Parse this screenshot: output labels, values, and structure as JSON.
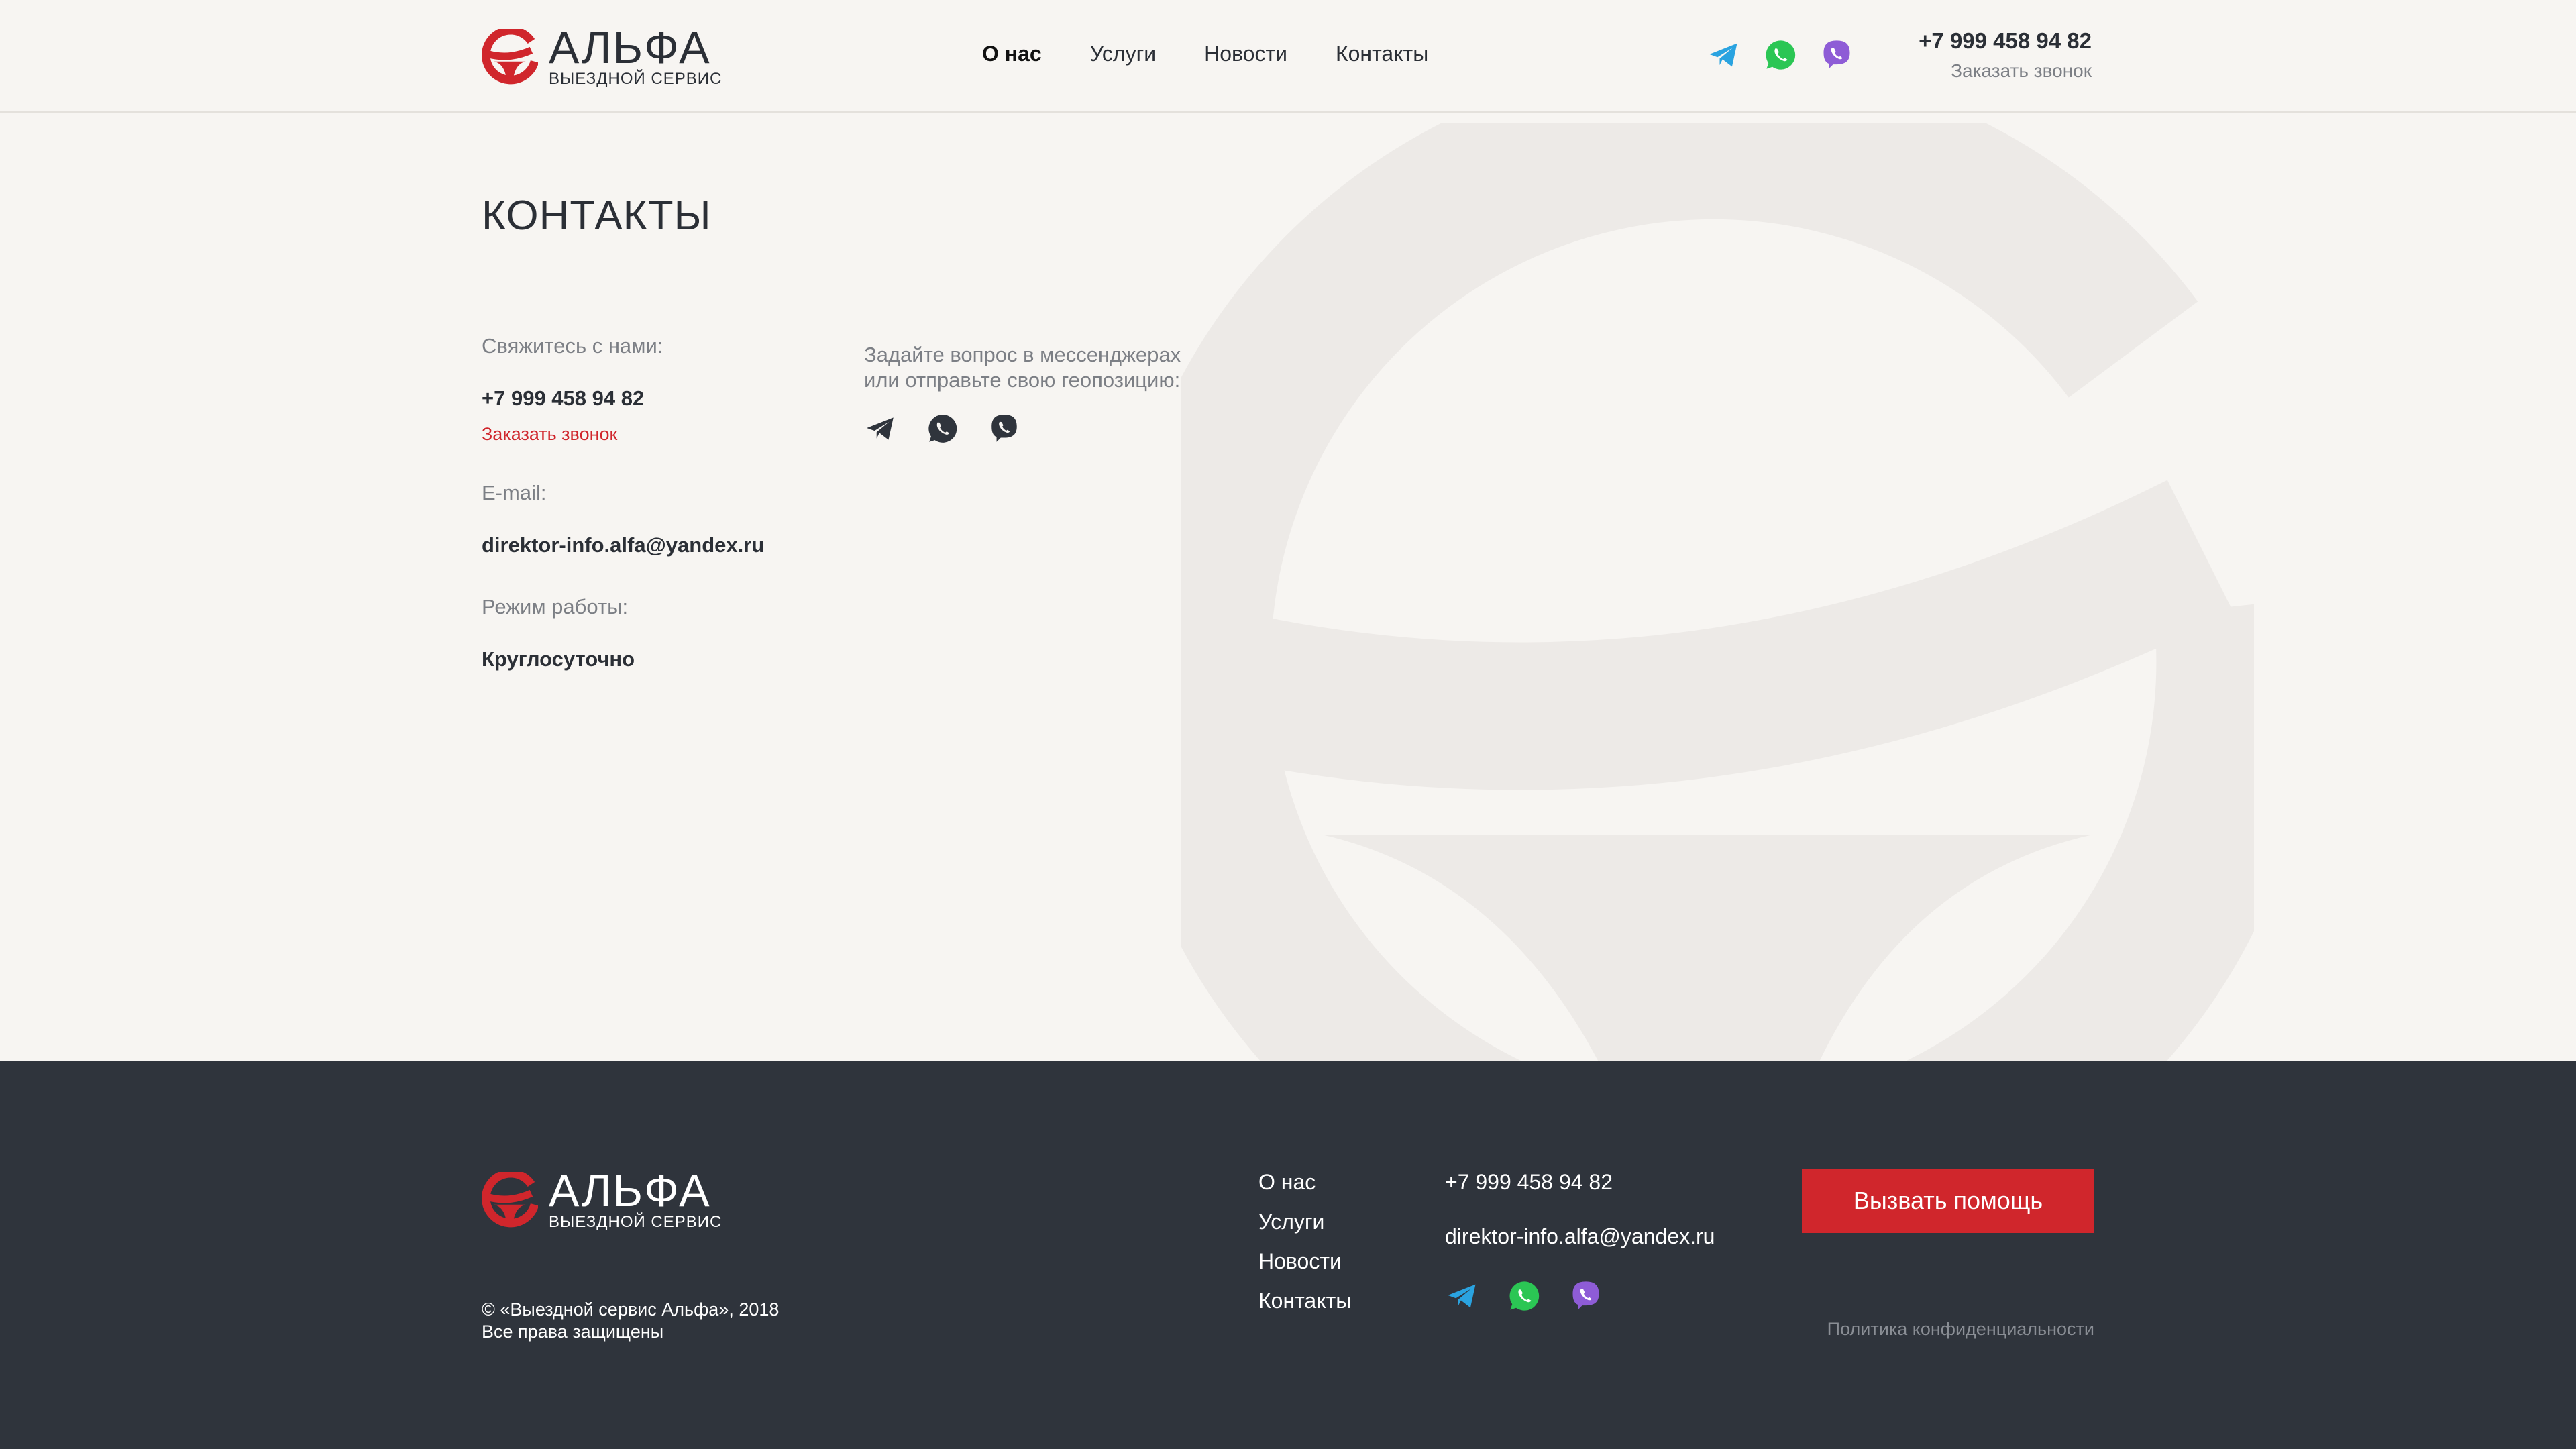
{
  "brand": {
    "name": "АЛЬФА",
    "tagline": "ВЫЕЗДНОЙ СЕРВИС",
    "accent": "#d0262c"
  },
  "header": {
    "nav": [
      "О нас",
      "Услуги",
      "Новости",
      "Контакты"
    ],
    "active_nav": "О нас",
    "messengers": [
      "telegram-icon",
      "whatsapp-icon",
      "viber-icon"
    ],
    "phone": "+7 999 458 94 82",
    "callback": "Заказать звонок"
  },
  "main": {
    "title": "КОНТАКТЫ",
    "contact_label": "Свяжитесь с нами:",
    "phone": "+7 999 458 94 82",
    "callback": "Заказать звонок",
    "email_label": "E-mail:",
    "email": "direktor-info.alfa@yandex.ru",
    "hours_label": "Режим работы:",
    "hours": "Круглосуточно",
    "messenger_prompt_line1": "Задайте вопрос в мессенджерах",
    "messenger_prompt_line2": "или отправьте свою геопозицию:"
  },
  "footer": {
    "copyright_line1": "© «Выездной сервис Альфа», 2018",
    "copyright_line2": "Все права защищены",
    "nav": [
      "О нас",
      "Услуги",
      "Новости",
      "Контакты"
    ],
    "phone": "+7 999 458 94 82",
    "email": "direktor-info.alfa@yandex.ru",
    "cta": "Вызвать помощь",
    "policy": "Политика конфиденциальности"
  },
  "colors": {
    "background": "#f7f5f2",
    "footer_bg": "#2f343c",
    "telegram": "#2aa3e0",
    "whatsapp": "#2bc654",
    "viber": "#8e5cd6",
    "watermark": "#edeae7"
  }
}
